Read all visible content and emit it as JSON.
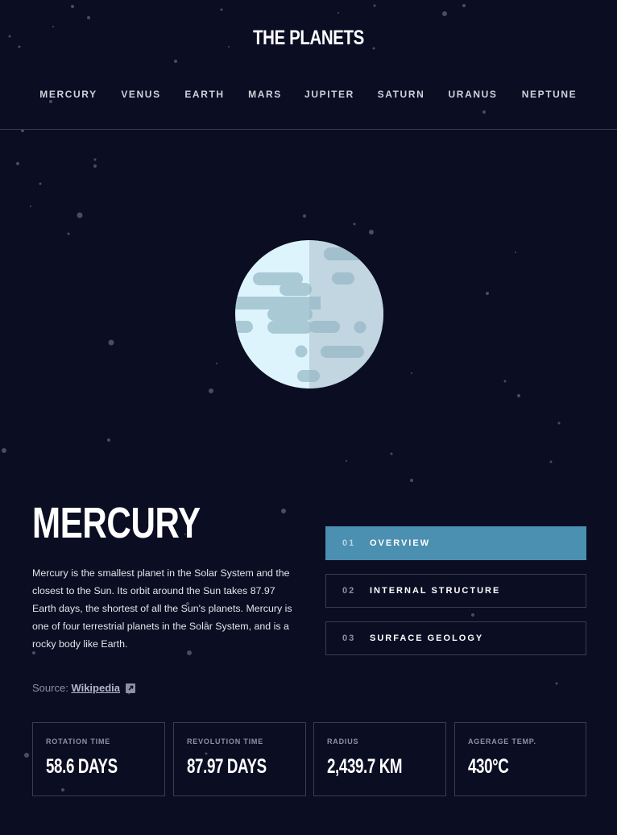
{
  "header": {
    "title": "THE PLANETS"
  },
  "nav": {
    "items": [
      "MERCURY",
      "VENUS",
      "EARTH",
      "MARS",
      "JUPITER",
      "SATURN",
      "URANUS",
      "NEPTUNE"
    ]
  },
  "planet": {
    "name": "MERCURY",
    "description": "Mercury is the smallest planet in the Solar System and the closest to the Sun. Its orbit around the Sun takes 87.97 Earth days, the shortest of all the Sun's planets. Mercury is one of four terrestrial planets in the Solar System, and is a rocky body like Earth.",
    "source_label": "Source:",
    "source_link": "Wikipedia"
  },
  "tabs": [
    {
      "num": "01",
      "label": "OVERVIEW",
      "active": true
    },
    {
      "num": "02",
      "label": "INTERNAL STRUCTURE",
      "active": false
    },
    {
      "num": "03",
      "label": "SURFACE GEOLOGY",
      "active": false
    }
  ],
  "stats": [
    {
      "label": "ROTATION TIME",
      "value": "58.6 DAYS"
    },
    {
      "label": "REVOLUTION TIME",
      "value": "87.97 DAYS"
    },
    {
      "label": "RADIUS",
      "value": "2,439.7 KM"
    },
    {
      "label": "AGERAGE TEMP.",
      "value": "430°C"
    }
  ],
  "colors": {
    "background": "#0b0d23",
    "accent": "#4b8fb1",
    "planet_light": "#def4fc",
    "planet_shadow": "#cbe1ea",
    "planet_crater": "#a9c9d5"
  }
}
